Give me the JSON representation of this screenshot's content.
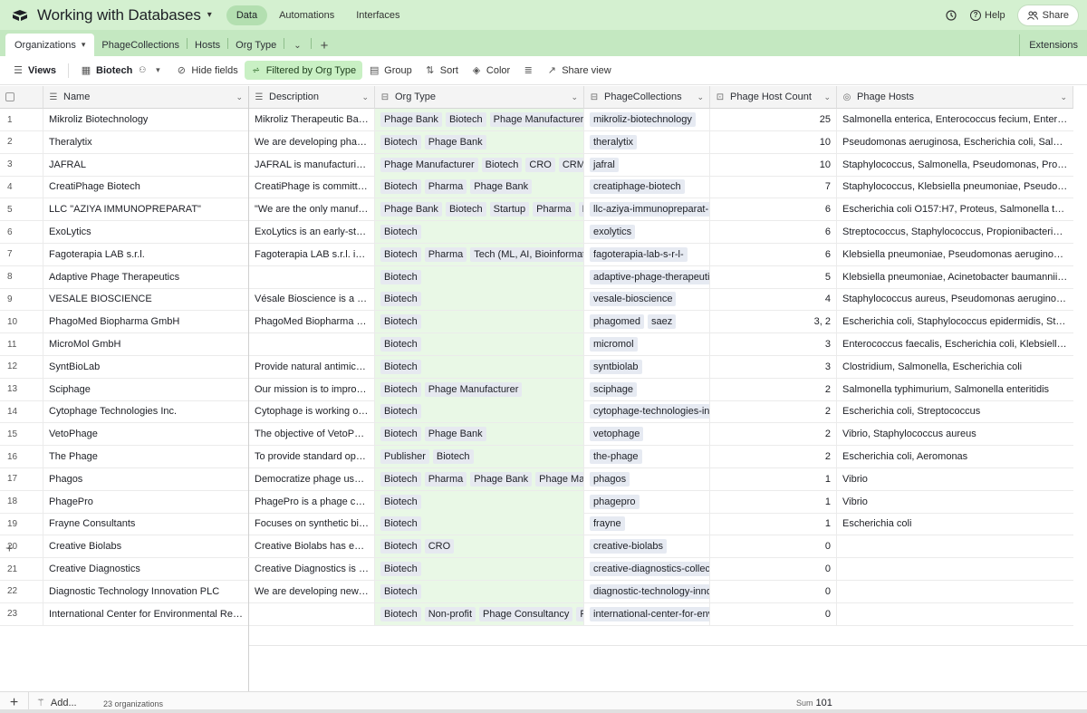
{
  "header": {
    "base_title": "Working with Databases",
    "nav": [
      "Data",
      "Automations",
      "Interfaces"
    ],
    "help_label": "Help",
    "share_label": "Share"
  },
  "tabs": {
    "active": "Organizations",
    "items": [
      "PhageCollections",
      "Hosts",
      "Org Type"
    ],
    "extensions_label": "Extensions"
  },
  "toolbar": {
    "views_label": "Views",
    "view_name": "Biotech",
    "hide_fields": "Hide fields",
    "filtered": "Filtered by Org Type",
    "group": "Group",
    "sort": "Sort",
    "color": "Color",
    "share_view": "Share view"
  },
  "columns": {
    "name": "Name",
    "description": "Description",
    "org_type": "Org Type",
    "phage_collections": "PhageCollections",
    "phage_host_count": "Phage Host Count",
    "phage_hosts": "Phage Hosts"
  },
  "rows": [
    {
      "n": "1",
      "name": "Mikroliz Biotechnology",
      "desc": "Mikroliz Therapeutic Bact...",
      "org": [
        "Phage Bank",
        "Biotech",
        "Phage Manufacturer"
      ],
      "coll": [
        "mikroliz-biotechnology"
      ],
      "count": "25",
      "hosts": "Salmonella enterica, Enterococcus fecium, Enteroc..."
    },
    {
      "n": "2",
      "name": "Theralytix",
      "desc": "We are developing phage...",
      "org": [
        "Biotech",
        "Phage Bank"
      ],
      "coll": [
        "theralytix"
      ],
      "count": "10",
      "hosts": "Pseudomonas aeruginosa, Escherichia coli, Salmon..."
    },
    {
      "n": "3",
      "name": "JAFRAL",
      "desc": "JAFRAL is manufacturing ...",
      "org": [
        "Phage Manufacturer",
        "Biotech",
        "CRO",
        "CRMO"
      ],
      "coll": [
        "jafral"
      ],
      "count": "10",
      "hosts": "Staphylococcus, Salmonella, Pseudomonas, Propio..."
    },
    {
      "n": "4",
      "name": "CreatiPhage Biotech",
      "desc": "CreatiPhage is committed...",
      "org": [
        "Biotech",
        "Pharma",
        "Phage Bank"
      ],
      "coll": [
        "creatiphage-biotech"
      ],
      "count": "7",
      "hosts": "Staphylococcus, Klebsiella pneumoniae, Pseudomo..."
    },
    {
      "n": "5",
      "name": "LLC \"AZIYA IMMUNOPREPARAT\"",
      "desc": "\"We are the only manufac...",
      "org": [
        "Phage Bank",
        "Biotech",
        "Startup",
        "Pharma",
        "Phage"
      ],
      "coll": [
        "llc-aziya-immunopreparat-"
      ],
      "count": "6",
      "hosts": "Escherichia coli O157:H7, Proteus, Salmonella typhi..."
    },
    {
      "n": "6",
      "name": "ExoLytics",
      "desc": "ExoLytics is an early-stag...",
      "org": [
        "Biotech"
      ],
      "coll": [
        "exolytics"
      ],
      "count": "6",
      "hosts": "Streptococcus, Staphylococcus, Propionibacterium..."
    },
    {
      "n": "7",
      "name": "Fagoterapia LAB s.r.l.",
      "desc": "Fagoterapia LAB s.r.l. is t...",
      "org": [
        "Biotech",
        "Pharma",
        "Tech (ML, AI, Bioinformatics)"
      ],
      "coll": [
        "fagoterapia-lab-s-r-l-"
      ],
      "count": "6",
      "hosts": "Klebsiella pneumoniae, Pseudomonas aeruginosa, ..."
    },
    {
      "n": "8",
      "name": "Adaptive Phage Therapeutics",
      "desc": "",
      "org": [
        "Biotech"
      ],
      "coll": [
        "adaptive-phage-therapeutic"
      ],
      "count": "5",
      "hosts": "Klebsiella pneumoniae, Acinetobacter baumannii, S..."
    },
    {
      "n": "9",
      "name": "VESALE BIOSCIENCE",
      "desc": "Vésale Bioscience is a Bel...",
      "org": [
        "Biotech"
      ],
      "coll": [
        "vesale-bioscience"
      ],
      "count": "4",
      "hosts": "Staphylococcus aureus, Pseudomonas aeruginosa, ..."
    },
    {
      "n": "10",
      "name": "PhagoMed Biopharma GmbH",
      "desc": "PhagoMed Biopharma G...",
      "org": [
        "Biotech"
      ],
      "coll": [
        "phagomed",
        "saez"
      ],
      "count": "3, 2",
      "hosts": "Escherichia coli, Staphylococcus epidermidis, Stap..."
    },
    {
      "n": "11",
      "name": "MicroMol GmbH",
      "desc": "",
      "org": [
        "Biotech"
      ],
      "coll": [
        "micromol"
      ],
      "count": "3",
      "hosts": "Enterococcus faecalis, Escherichia coli, Klebsiella p..."
    },
    {
      "n": "12",
      "name": "SyntBioLab",
      "desc": "Provide natural antimicro...",
      "org": [
        "Biotech"
      ],
      "coll": [
        "syntbiolab"
      ],
      "count": "3",
      "hosts": "Clostridium, Salmonella, Escherichia coli"
    },
    {
      "n": "13",
      "name": "Sciphage",
      "desc": "Our mission is to improve ...",
      "org": [
        "Biotech",
        "Phage Manufacturer"
      ],
      "coll": [
        "sciphage"
      ],
      "count": "2",
      "hosts": "Salmonella typhimurium, Salmonella enteritidis"
    },
    {
      "n": "14",
      "name": "Cytophage Technologies Inc.",
      "desc": "Cytophage is working on ...",
      "org": [
        "Biotech"
      ],
      "coll": [
        "cytophage-technologies-inc"
      ],
      "count": "2",
      "hosts": "Escherichia coli, Streptococcus"
    },
    {
      "n": "15",
      "name": "VetoPhage",
      "desc": "The objective of VetoPha...",
      "org": [
        "Biotech",
        "Phage Bank"
      ],
      "coll": [
        "vetophage"
      ],
      "count": "2",
      "hosts": "Vibrio, Staphylococcus aureus"
    },
    {
      "n": "16",
      "name": "The Phage",
      "desc": "To provide standard oper...",
      "org": [
        "Publisher",
        "Biotech"
      ],
      "coll": [
        "the-phage"
      ],
      "count": "2",
      "hosts": "Escherichia coli, Aeromonas"
    },
    {
      "n": "17",
      "name": "Phagos",
      "desc": "Democratize phage use - ...",
      "org": [
        "Biotech",
        "Pharma",
        "Phage Bank",
        "Phage Manufac"
      ],
      "coll": [
        "phagos"
      ],
      "count": "1",
      "hosts": "Vibrio"
    },
    {
      "n": "18",
      "name": "PhagePro",
      "desc": "PhagePro is a phage com...",
      "org": [
        "Biotech"
      ],
      "coll": [
        "phagepro"
      ],
      "count": "1",
      "hosts": "Vibrio"
    },
    {
      "n": "19",
      "name": "Frayne Consultants",
      "desc": "Focuses on synthetic biol...",
      "org": [
        "Biotech"
      ],
      "coll": [
        "frayne"
      ],
      "count": "1",
      "hosts": "Escherichia coli"
    },
    {
      "n": "20",
      "name": "Creative Biolabs",
      "desc": "Creative Biolabs has enga...",
      "org": [
        "Biotech",
        "CRO"
      ],
      "coll": [
        "creative-biolabs"
      ],
      "count": "0",
      "hosts": ""
    },
    {
      "n": "21",
      "name": "Creative Diagnostics",
      "desc": "Creative Diagnostics is a l...",
      "org": [
        "Biotech"
      ],
      "coll": [
        "creative-diagnostics-collec"
      ],
      "count": "0",
      "hosts": ""
    },
    {
      "n": "22",
      "name": "Diagnostic Technology Innovation PLC",
      "desc": "We are developing new af...",
      "org": [
        "Biotech"
      ],
      "coll": [
        "diagnostic-technology-inno"
      ],
      "count": "0",
      "hosts": ""
    },
    {
      "n": "23",
      "name": "International Center for Environmental Rese...",
      "desc": "",
      "org": [
        "Biotech",
        "Non-profit",
        "Phage Consultancy",
        "Publ"
      ],
      "coll": [
        "international-center-for-env"
      ],
      "count": "0",
      "hosts": ""
    }
  ],
  "footer": {
    "add_label": "Add...",
    "record_count": "23 organizations",
    "sum_label": "Sum",
    "sum_value": "101"
  }
}
